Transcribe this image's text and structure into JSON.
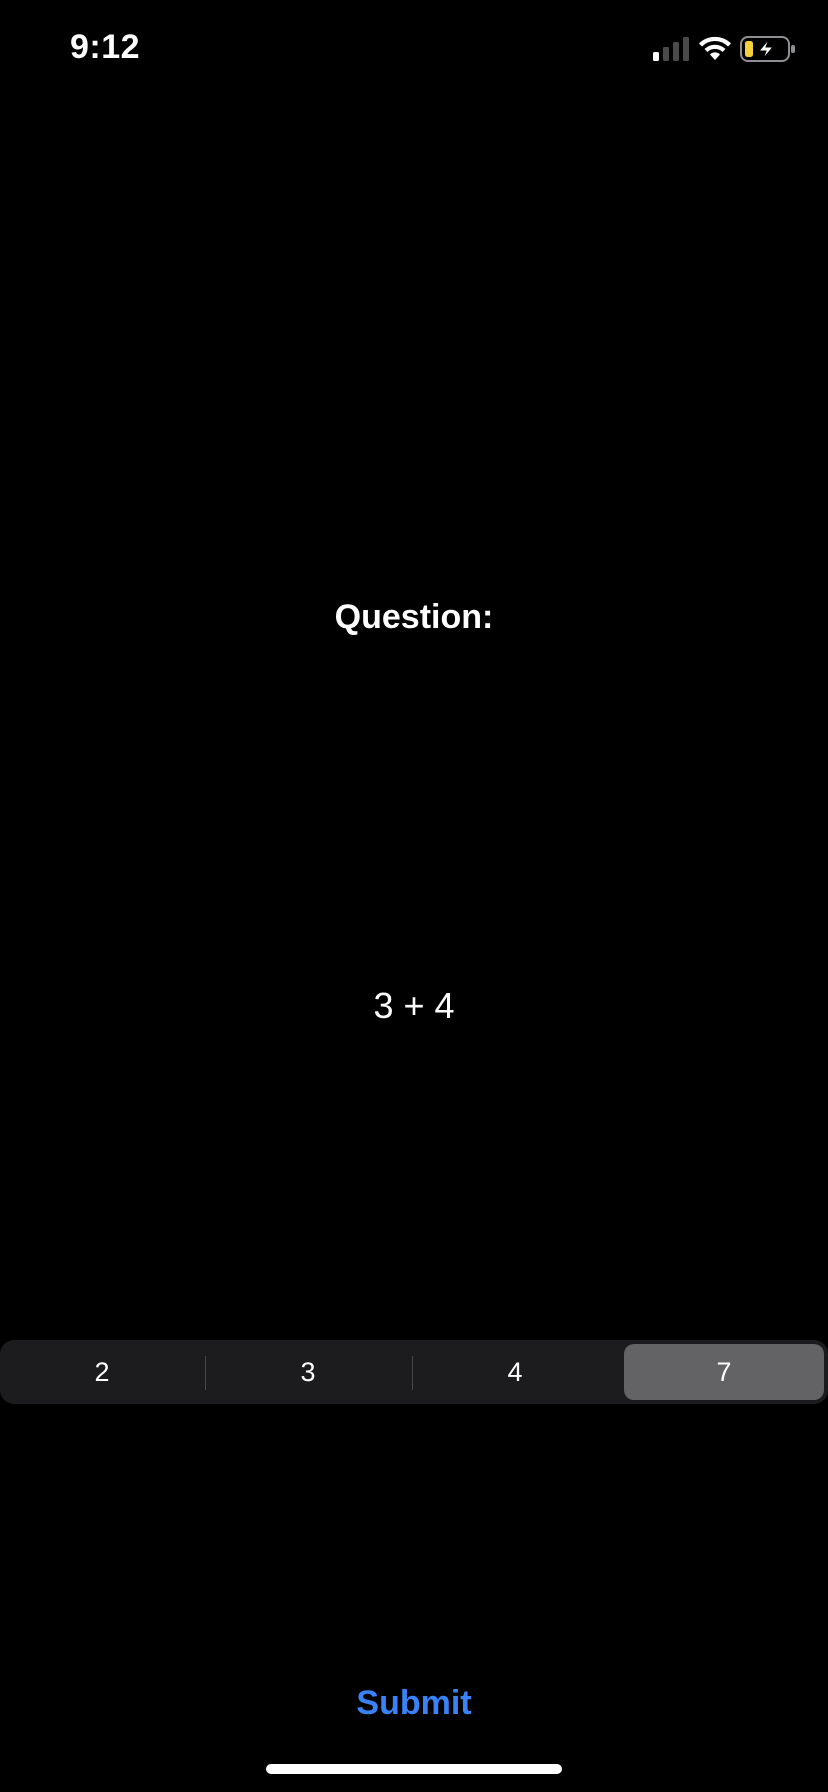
{
  "status_bar": {
    "time": "9:12",
    "icons": [
      "cellular-signal-icon",
      "wifi-icon",
      "battery-charging-icon"
    ],
    "battery_color": "#f4d03f"
  },
  "question": {
    "title": "Question:",
    "expression": "3 + 4"
  },
  "answer_options": {
    "options": [
      "2",
      "3",
      "4",
      "7"
    ],
    "selected_value": "7"
  },
  "submit": {
    "label": "Submit",
    "color": "#3a82f7"
  },
  "colors": {
    "background": "#000000",
    "segment_background": "#1c1c1e",
    "segment_selected": "#636366"
  }
}
